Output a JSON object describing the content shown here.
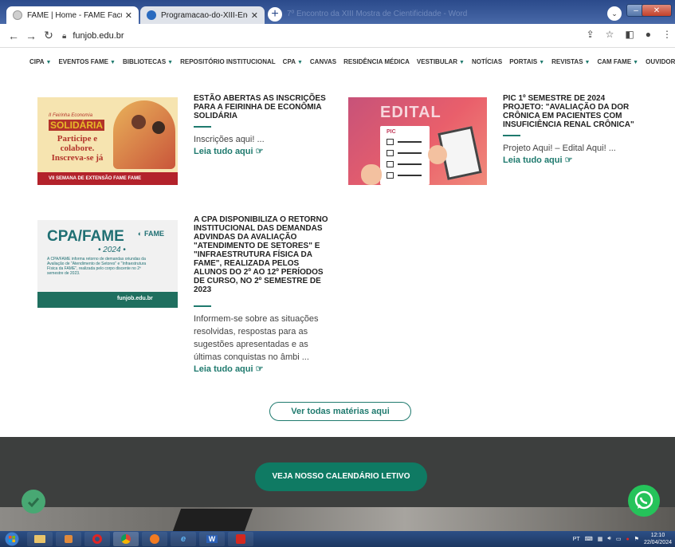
{
  "browser": {
    "tabs": [
      {
        "title": "FAME | Home - FAME Faculdade",
        "active": true,
        "favicon_color": "#cfcfcf"
      },
      {
        "title": "Programacao-do-XIII-Encontro-d",
        "active": false,
        "favicon_color": "#2a6bbf"
      }
    ],
    "ghost_tab_text": "7º Encontro da XIII Mostra de Cientificidade - Word",
    "new_tab_symbol": "+",
    "url": "funjob.edu.br",
    "back_icon": "←",
    "forward_icon": "→",
    "reload_icon": "↻"
  },
  "site_nav": {
    "items": [
      {
        "label": "CIPA",
        "caret": true
      },
      {
        "label": "EVENTOS FAME",
        "caret": true
      },
      {
        "label": "BIBLIOTECAS",
        "caret": true
      },
      {
        "label": "REPOSITÓRIO INSTITUCIONAL",
        "caret": false
      },
      {
        "label": "CPA",
        "caret": true
      },
      {
        "label": "CANVAS",
        "caret": false
      },
      {
        "label": "RESIDÊNCIA MÉDICA",
        "caret": false
      },
      {
        "label": "VESTIBULAR",
        "caret": true
      },
      {
        "label": "NOTÍCIAS",
        "caret": false
      },
      {
        "label": "PORTAIS",
        "caret": true
      },
      {
        "label": "REVISTAS",
        "caret": true
      },
      {
        "label": "CAM FAME",
        "caret": true
      },
      {
        "label": "OUVIDORIA",
        "caret": false
      }
    ]
  },
  "posts": [
    {
      "title": "ESTÃO ABERTAS AS INSCRIÇÕES PARA A FEIRINHA DE ECONÔMIA SOLIDÁRIA",
      "excerpt": "Inscrições aqui! ...",
      "read_more": "Leia tudo aqui",
      "image": {
        "kicker": "II Feirinha Economia",
        "headline": "SOLIDÁRIA",
        "cta": "Participe e colabore. Inscreva-se já",
        "footer": "VII SEMANA DE EXTENSÃO   FAME   FAME"
      }
    },
    {
      "title": "PIC 1º SEMESTRE DE 2024 PROJETO: \"AVALIAÇÃO DA DOR CRÔNICA EM PACIENTES COM INSUFICIÊNCIA RENAL CRÔNICA\"",
      "excerpt": "Projeto Aqui! – Edital Aqui! ...",
      "read_more": "Leia tudo aqui",
      "image": {
        "headline": "EDITAL",
        "tag": "PIC"
      }
    },
    {
      "title": "A CPA DISPONIBILIZA O RETORNO INSTITUCIONAL DAS DEMANDAS ADVINDAS DA AVALIAÇÃO \"ATENDIMENTO DE SETORES\" E \"INFRAESTRUTURA FÍSICA DA FAME\", REALIZADA PELOS ALUNOS DO 2º AO 12º PERÍODOS DE CURSO, NO 2º SEMESTRE DE 2023",
      "excerpt": "Informem-se sobre as situações resolvidas, respostas para as sugestões apresentadas e as últimas conquistas no âmbi ...",
      "read_more": "Leia tudo aqui",
      "image": {
        "headline": "CPA/FAME",
        "year": "• 2024 •",
        "brand": "FAME",
        "body": "A CPA/FAME informa retorno de demandas oriundas da Avaliação de \"Atendimento de Setores\" e \"Infraestrutura Física da FAME\", realizada pelo corpo discente no 2º semestre de 2023.",
        "footer": "funjob.edu.br"
      }
    }
  ],
  "see_all": "Ver todas matérias aqui",
  "calendar_button": "VEJA NOSSO CALENDÁRIO LETIVO",
  "taskbar": {
    "word_label": "W",
    "tray_lang": "PT",
    "time": "12:10",
    "date": "22/04/2024"
  },
  "colors": {
    "accent": "#1f7a6e",
    "cal_button": "#0f7a63",
    "whatsapp": "#25c35a",
    "footer_bg": "#3d3f3e"
  }
}
